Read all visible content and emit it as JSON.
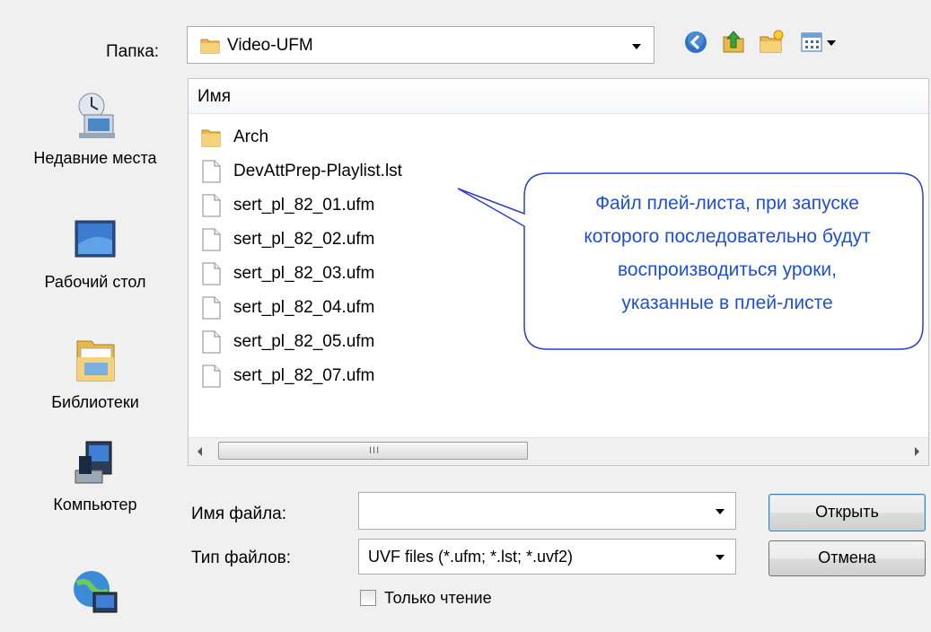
{
  "toolbar": {
    "folder_label": "Папка:",
    "folder_value": "Video-UFM",
    "icons": [
      "back-icon",
      "up-folder-icon",
      "new-folder-icon",
      "view-menu-icon"
    ]
  },
  "places": [
    {
      "label": "Недавние места",
      "icon": "recent-places-icon"
    },
    {
      "label": "Рабочий стол",
      "icon": "desktop-icon"
    },
    {
      "label": "Библиотеки",
      "icon": "libraries-icon"
    },
    {
      "label": "Компьютер",
      "icon": "computer-icon"
    },
    {
      "label": "",
      "icon": "network-icon"
    }
  ],
  "list": {
    "column_header": "Имя",
    "items": [
      {
        "name": "Arch",
        "type": "folder"
      },
      {
        "name": "DevAttPrep-Playlist.lst",
        "type": "file"
      },
      {
        "name": "sert_pl_82_01.ufm",
        "type": "file"
      },
      {
        "name": "sert_pl_82_02.ufm",
        "type": "file"
      },
      {
        "name": "sert_pl_82_03.ufm",
        "type": "file"
      },
      {
        "name": "sert_pl_82_04.ufm",
        "type": "file"
      },
      {
        "name": "sert_pl_82_05.ufm",
        "type": "file"
      },
      {
        "name": "sert_pl_82_07.ufm",
        "type": "file"
      }
    ],
    "scroll_grip": "III"
  },
  "callout": {
    "lines": [
      "Файл плей-листа, при запуске",
      "которого последовательно будут",
      "воспроизводиться уроки,",
      "указанные в плей-листе"
    ],
    "color": "#1f4fd6"
  },
  "form": {
    "filename_label": "Имя файла:",
    "filename_value": "",
    "filetype_label": "Тип файлов:",
    "filetype_value": "UVF files (*.ufm; *.lst; *.uvf2)",
    "open_label": "Открыть",
    "cancel_label": "Отмена",
    "readonly_label": "Только чтение",
    "readonly_checked": false
  }
}
